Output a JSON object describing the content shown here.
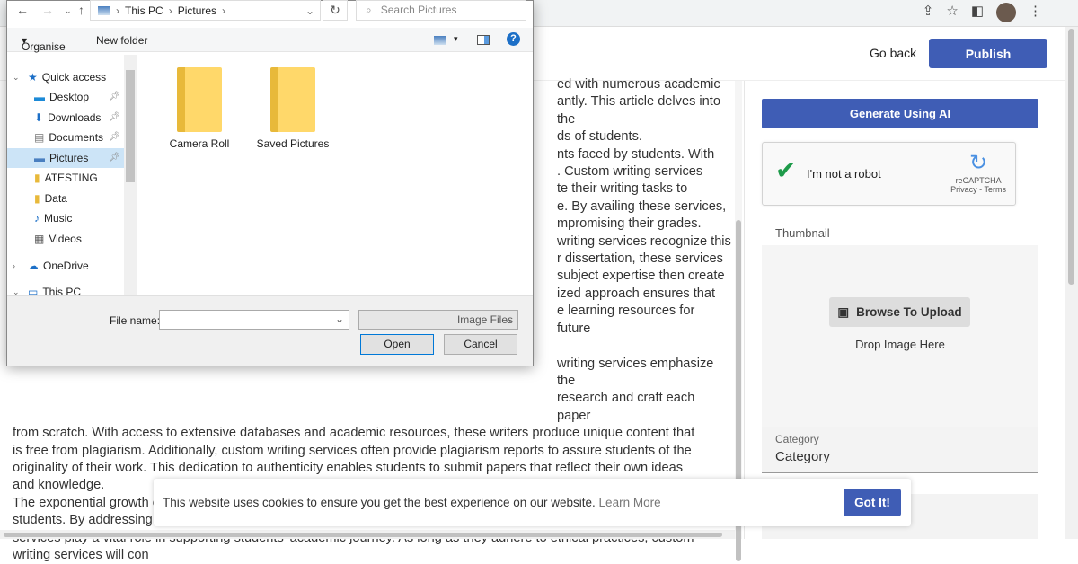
{
  "browser": {
    "icons": [
      "share-icon",
      "star-icon",
      "sidebar-icon",
      "menu-icon"
    ]
  },
  "header": {
    "go_back": "Go back",
    "publish": "Publish"
  },
  "article": {
    "partial_lines": [
      "ed with numerous academic",
      "antly. This article delves into the",
      "ds of students.",
      "nts faced by students. With",
      ". Custom writing services",
      "te their writing tasks to",
      "e. By availing these services,",
      "mpromising their grades.",
      "writing services recognize this",
      "r dissertation, these services",
      "subject expertise then create",
      "ized approach ensures that",
      "e learning resources for future",
      "",
      "writing services emphasize the",
      "research and craft each paper"
    ],
    "lines": [
      "from scratch. With access to extensive databases and academic resources, these writers produce unique content that",
      "is free from plagiarism. Additionally, custom writing services often provide plagiarism reports to assure students of the",
      "originality of their work. This dedication to authenticity enables students to submit papers that reflect their own ideas",
      "and knowledge.",
      "The exponential growth of custom writing services can be attributed to their ability to meet the diverse needs of",
      "students. By addressing time constraints, accommodating individual requirements, and ensuring originality, these",
      "services play a vital role in supporting students' academic journey. As long as they adhere to ethical practices, custom",
      "writing services will con"
    ]
  },
  "panel": {
    "generate": "Generate Using AI",
    "captcha": {
      "label": "I'm not a robot",
      "brand": "reCAPTCHA",
      "links": "Privacy - Terms"
    },
    "thumbnail_label": "Thumbnail",
    "browse": "Browse To Upload",
    "drop": "Drop Image Here",
    "category_label": "Category",
    "category_value": "Category"
  },
  "cookie": {
    "text": "This website uses cookies to ensure you get the best experience on our website.",
    "learn_more": "Learn More",
    "got_it": "Got It!"
  },
  "dialog": {
    "path": [
      "This PC",
      "Pictures"
    ],
    "search_placeholder": "Search Pictures",
    "organise": "Organise",
    "new_folder": "New folder",
    "tree": [
      {
        "label": "Quick access",
        "icon": "star-icon"
      },
      {
        "label": "Desktop",
        "icon": "desktop-icon"
      },
      {
        "label": "Downloads",
        "icon": "download-icon"
      },
      {
        "label": "Documents",
        "icon": "documents-icon"
      },
      {
        "label": "Pictures",
        "icon": "pictures-icon"
      },
      {
        "label": "ATESTING",
        "icon": "folder-icon"
      },
      {
        "label": "Data",
        "icon": "folder-icon"
      },
      {
        "label": "Music",
        "icon": "music-icon"
      },
      {
        "label": "Videos",
        "icon": "videos-icon"
      },
      {
        "label": "OneDrive",
        "icon": "cloud-icon"
      },
      {
        "label": "This PC",
        "icon": "pc-icon"
      }
    ],
    "files": [
      "Camera Roll",
      "Saved Pictures"
    ],
    "file_name_label": "File name:",
    "file_name_value": "",
    "file_type": "Image Files",
    "open": "Open",
    "cancel": "Cancel"
  }
}
